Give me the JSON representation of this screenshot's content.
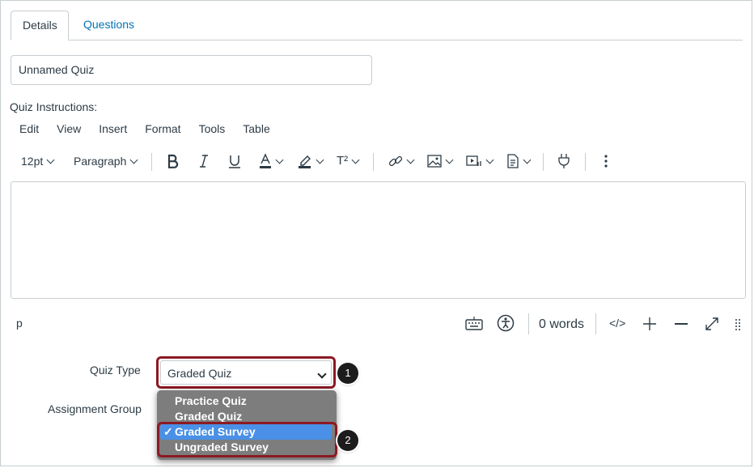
{
  "tabs": [
    {
      "label": "Details",
      "active": true
    },
    {
      "label": "Questions",
      "active": false
    }
  ],
  "quiz_title": {
    "value": "Unnamed Quiz"
  },
  "instructions_label": "Quiz Instructions:",
  "editor": {
    "menu": [
      "Edit",
      "View",
      "Insert",
      "Format",
      "Tools",
      "Table"
    ],
    "font_size": "12pt",
    "block_format": "Paragraph",
    "superscript_label": "T²",
    "status_path": "p",
    "word_count": "0 words",
    "html_toggle": "</>"
  },
  "form": {
    "quiz_type_label": "Quiz Type",
    "quiz_type_value": "Graded Quiz",
    "assignment_group_label": "Assignment Group"
  },
  "dropdown": {
    "options": [
      "Practice Quiz",
      "Graded Quiz",
      "Graded Survey",
      "Ungraded Survey"
    ],
    "selected": "Graded Survey",
    "check": "✓"
  },
  "callouts": [
    "1",
    "2"
  ],
  "colors": {
    "link": "#0374b5",
    "highlight": "#8b1a22",
    "selected_option": "#4a90e6"
  }
}
